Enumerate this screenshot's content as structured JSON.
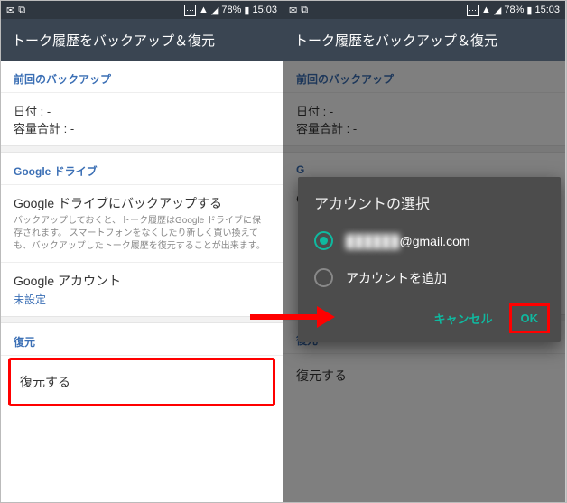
{
  "status": {
    "battery_pct": "78%",
    "time": "15:03"
  },
  "title": "トーク履歴をバックアップ＆復元",
  "sections": {
    "last_backup": {
      "header": "前回のバックアップ",
      "date_label": "日付",
      "date_value": ": -",
      "size_label": "容量合計",
      "size_value": ": -"
    },
    "gdrive": {
      "header": "Google ドライブ",
      "backup_label": "Google ドライブにバックアップする",
      "backup_desc": "バックアップしておくと、トーク履歴はGoogle ドライブに保存されます。\nスマートフォンをなくしたり新しく買い換えても、バックアップしたトーク履歴を復元することが出来ます。",
      "account_label": "Google アカウント",
      "account_value": "未設定"
    },
    "restore": {
      "header": "復元",
      "restore_label": "復元する"
    }
  },
  "dialog": {
    "title": "アカウントの選択",
    "option_email_masked": "██████",
    "option_email_suffix": "@gmail.com",
    "option_add": "アカウントを追加",
    "cancel": "キャンセル",
    "ok": "OK"
  }
}
